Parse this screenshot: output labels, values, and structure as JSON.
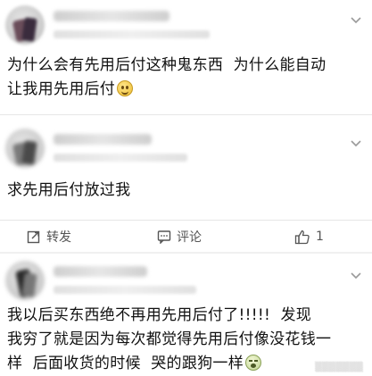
{
  "posts": [
    {
      "text_line1": "为什么会有先用后付这种鬼东西  为什么能自动",
      "text_line2": "让我用先用后付",
      "emoji": "smile-emoji"
    },
    {
      "text_line1": "求先用后付放过我"
    },
    {
      "text_line1": "我以后买东西绝不再用先用后付了!!!!!  发现",
      "text_line2": "我穷了就是因为每次都觉得先用后付像没花钱一",
      "text_line3": "样  后面收货的时候  哭的跟狗一样",
      "emoji": "cry-emoji"
    }
  ],
  "actions": {
    "repost_label": "转发",
    "comment_label": "评论",
    "like_count": "1"
  },
  "icons": {
    "repost": "repost-icon",
    "comment": "comment-icon",
    "like": "like-icon",
    "menu": "chevron-down-icon"
  }
}
